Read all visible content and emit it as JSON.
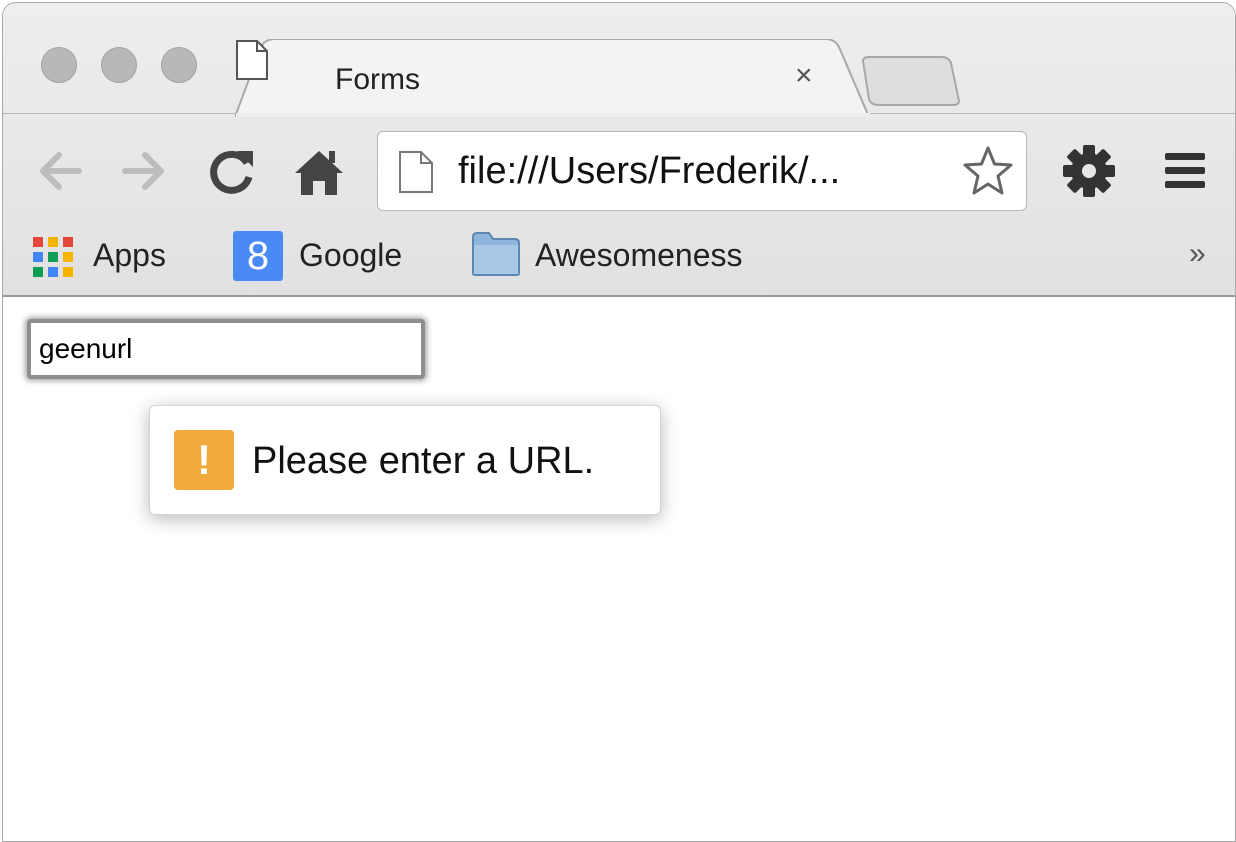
{
  "tab": {
    "title": "Forms",
    "close_glyph": "×"
  },
  "omnibox": {
    "url": "file:///Users/Frederik/..."
  },
  "bookmarks": [
    {
      "label": "Apps",
      "icon": "apps-grid-icon"
    },
    {
      "label": "Google",
      "icon": "google-icon",
      "icon_letter": "8"
    },
    {
      "label": "Awesomeness",
      "icon": "folder-icon"
    }
  ],
  "bookmarks_overflow": "»",
  "form": {
    "input_value": "geenurl"
  },
  "validation": {
    "message": "Please enter a URL.",
    "icon_glyph": "!"
  },
  "colors": {
    "warning": "#f2a93b",
    "google_blue": "#4a8af4"
  }
}
